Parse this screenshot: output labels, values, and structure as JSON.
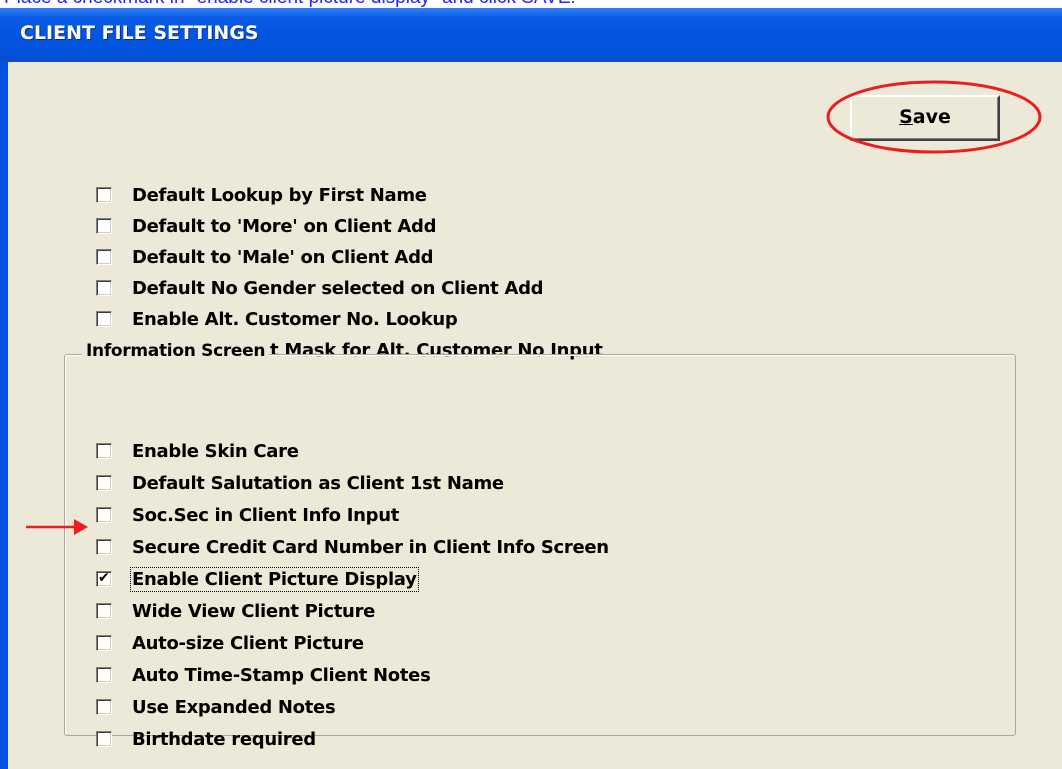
{
  "instruction": "Place a checkmark in \"enable client picture display\" and click SAVE.",
  "window": {
    "title": "CLIENT FILE SETTINGS"
  },
  "save_button": {
    "label_prefix": "",
    "label_underlined": "S",
    "label_rest": "ave"
  },
  "general_options": [
    {
      "label": "Default Lookup by First Name",
      "checked": false
    },
    {
      "label": "Default to 'More' on Client Add",
      "checked": false
    },
    {
      "label": "Default to 'Male' on Client Add",
      "checked": false
    },
    {
      "label": "Default No Gender selected on Client Add",
      "checked": false
    },
    {
      "label": "Enable Alt. Customer No. Lookup",
      "checked": false
    },
    {
      "label": "Use Edit Mask for Alt. Customer No Input",
      "checked": false
    }
  ],
  "information_screen": {
    "caption": "Information Screen",
    "options": [
      {
        "label": "Enable Skin Care",
        "checked": false
      },
      {
        "label": "Default Salutation as Client 1st Name",
        "checked": false
      },
      {
        "label": "Soc.Sec in Client Info Input",
        "checked": false
      },
      {
        "label": "Secure Credit Card Number in Client Info Screen",
        "checked": false
      },
      {
        "label": "Enable Client Picture Display",
        "checked": true
      },
      {
        "label": "Wide View Client Picture",
        "checked": false
      },
      {
        "label": "Auto-size Client Picture",
        "checked": false
      },
      {
        "label": "Auto Time-Stamp Client Notes",
        "checked": false
      },
      {
        "label": "Use Expanded Notes",
        "checked": false
      },
      {
        "label": "Birthdate required",
        "checked": false
      }
    ]
  },
  "colors": {
    "annotation_red": "#ee1c1c",
    "instruction_blue": "#2525ff",
    "titlebar_blue": "#0355e0",
    "dialog_face": "#ece9d8"
  }
}
